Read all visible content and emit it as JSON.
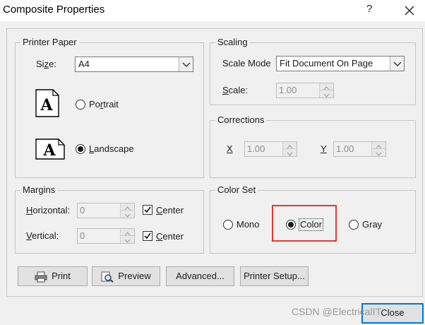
{
  "window": {
    "title": "Composite Properties",
    "help_label": "?"
  },
  "printer_paper": {
    "legend": "Printer Paper",
    "size_label": "Size:",
    "size_value": "A4",
    "portrait_label": "Portrait",
    "landscape_label": "Landscape",
    "selected_orientation": "Landscape",
    "icon_glyph": "A"
  },
  "scaling": {
    "legend": "Scaling",
    "scale_mode_label": "Scale Mode",
    "scale_mode_value": "Fit Document On Page",
    "scale_label": "Scale:",
    "scale_value": "1.00"
  },
  "corrections": {
    "legend": "Corrections",
    "x_label": "X",
    "x_value": "1.00",
    "y_label": "Y",
    "y_value": "1.00"
  },
  "margins": {
    "legend": "Margins",
    "horizontal_label": "Horizontal:",
    "horizontal_value": "0",
    "vertical_label": "Vertical:",
    "vertical_value": "0",
    "center_label": "Center",
    "center_h_checked": true,
    "center_v_checked": true
  },
  "color_set": {
    "legend": "Color Set",
    "options": [
      "Mono",
      "Color",
      "Gray"
    ],
    "selected": "Color"
  },
  "buttons": {
    "print": "Print",
    "preview": "Preview",
    "advanced": "Advanced...",
    "printer_setup": "Printer Setup...",
    "close": "Close"
  },
  "watermark": "CSDN @ElectricalIT",
  "colors": {
    "highlight": "#e53935",
    "default_button_border": "#0078d7"
  }
}
